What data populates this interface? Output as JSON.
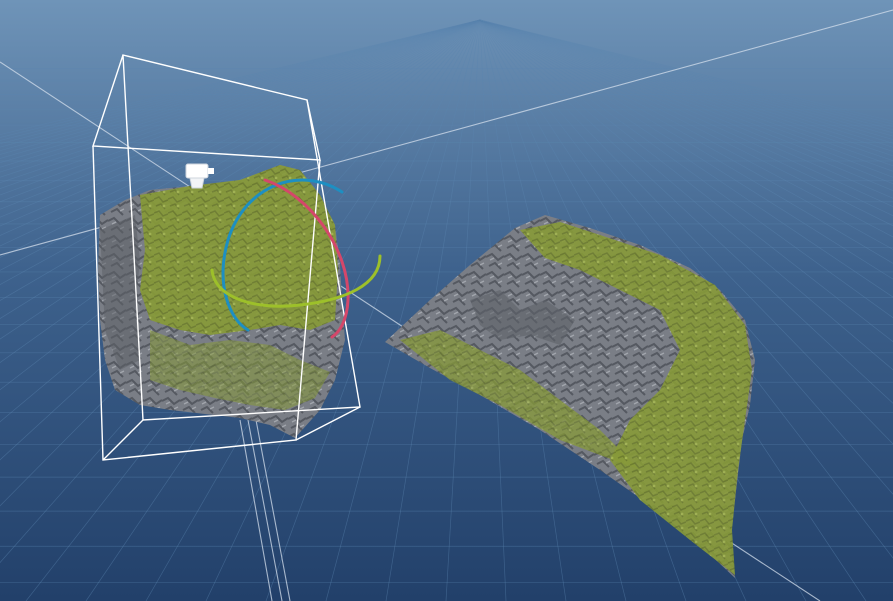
{
  "viewport": {
    "sky_top_color": "#6f94b8",
    "sky_bottom_color": "#24436a",
    "grid_line_color": "#4f7aa8",
    "grid_axis_color": "#c9d6e6"
  },
  "scene": {
    "objects": [
      {
        "name": "rock-cube",
        "selected": true,
        "top_color": "#8a9a3a",
        "side_color": "#6d7178"
      },
      {
        "name": "rock-slab",
        "selected": false,
        "top_color": "#879736",
        "side_color": "#6b6f76"
      }
    ],
    "gizmo": {
      "type": "rotate",
      "x_ring_color": "#d4476a",
      "y_ring_color": "#9dc02a",
      "z_ring_color": "#1d8fc2"
    },
    "bounding_box_color": "#ffffff",
    "pivot_icon": "camera-icon"
  }
}
